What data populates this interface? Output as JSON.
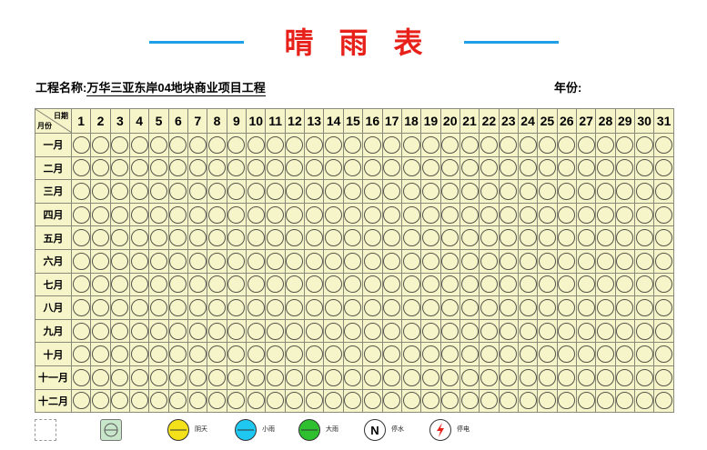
{
  "header": {
    "title": "晴雨表",
    "project_label": "工程名称:",
    "project_value": "万华三亚东岸04地块商业项目工程",
    "year_label": "年份:"
  },
  "table": {
    "corner_day": "日期",
    "corner_month": "月份",
    "days": [
      "1",
      "2",
      "3",
      "4",
      "5",
      "6",
      "7",
      "8",
      "9",
      "10",
      "11",
      "12",
      "13",
      "14",
      "15",
      "16",
      "17",
      "18",
      "19",
      "20",
      "21",
      "22",
      "23",
      "24",
      "25",
      "26",
      "27",
      "28",
      "29",
      "30",
      "31"
    ],
    "months": [
      "一月",
      "二月",
      "三月",
      "四月",
      "五月",
      "六月",
      "七月",
      "八月",
      "九月",
      "十月",
      "十一月",
      "十二月"
    ]
  },
  "legend": [
    {
      "icon": "sunny-icon",
      "label": "",
      "color": "#ffffff"
    },
    {
      "icon": "cloudy-icon",
      "label": "",
      "color": "#c8e6c9"
    },
    {
      "icon": "yellow-circle-icon",
      "label": "阴天",
      "color": "#f5e11a"
    },
    {
      "icon": "cyan-circle-icon",
      "label": "小雨",
      "color": "#1ec8f0"
    },
    {
      "icon": "green-circle-icon",
      "label": "大雨",
      "color": "#2ec02e"
    },
    {
      "icon": "n-circle-icon",
      "label": "停水",
      "color": "#ffffff"
    },
    {
      "icon": "lightning-circle-icon",
      "label": "停电",
      "color": "#ffffff"
    }
  ],
  "colors": {
    "title": "#e8201a",
    "title_lines": "#1e9fe6",
    "grid_fill": "#f6f4c9"
  }
}
